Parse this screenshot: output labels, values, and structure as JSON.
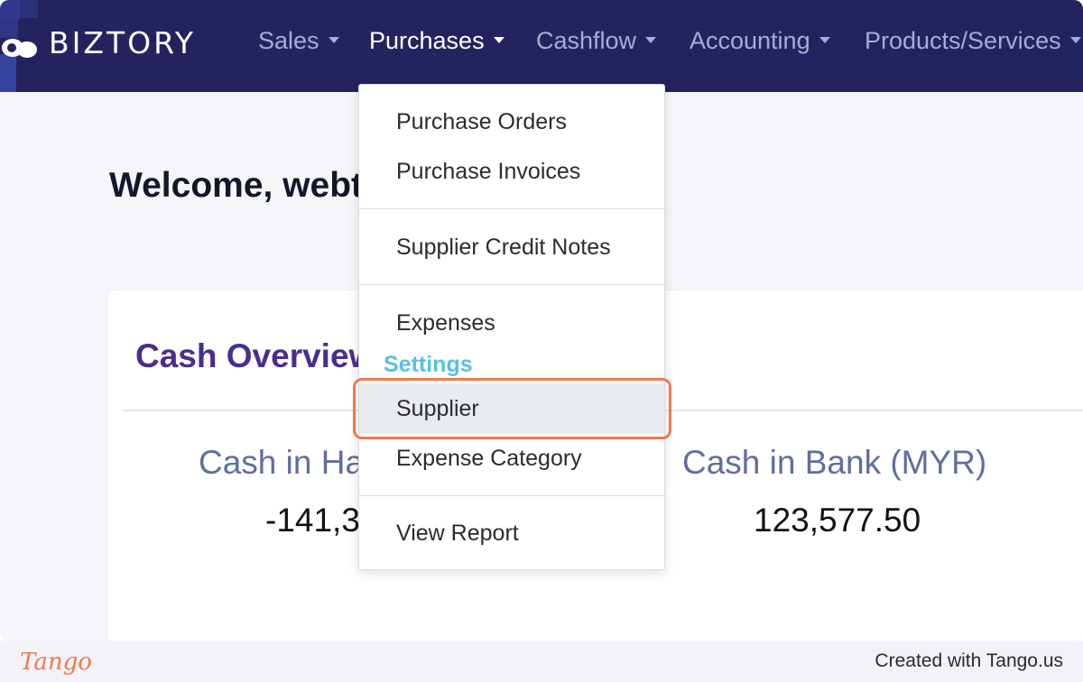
{
  "brand": {
    "name": "BIZTORY"
  },
  "nav": {
    "items": [
      {
        "label": "Sales"
      },
      {
        "label": "Purchases"
      },
      {
        "label": "Cashflow"
      },
      {
        "label": "Accounting"
      },
      {
        "label": "Products/Services"
      }
    ],
    "active": "Purchases"
  },
  "page": {
    "welcome": "Welcome, webt"
  },
  "cash_overview": {
    "title": "Cash Overview",
    "cash_in_hand_label": "Cash in Ha",
    "cash_in_hand_value": "-141,3",
    "cash_in_bank_label": "Cash in Bank (MYR)",
    "cash_in_bank_value": "123,577.50"
  },
  "dropdown": {
    "items": [
      {
        "label": "Purchase Orders"
      },
      {
        "label": "Purchase Invoices"
      },
      {
        "label": "Supplier Credit Notes"
      },
      {
        "label": "Expenses"
      }
    ],
    "settings_header": "Settings",
    "settings_items": [
      {
        "label": "Supplier"
      },
      {
        "label": "Expense Category"
      }
    ],
    "report_item": "View Report",
    "highlighted": "Supplier"
  },
  "footer": {
    "logo": "Tango",
    "credit": "Created with Tango.us"
  },
  "colors": {
    "navbar": "#25235f",
    "active_nav": "#ffffff",
    "inactive_nav": "#a9abd3",
    "card_title": "#4a2e8e",
    "settings_header": "#57c0e6",
    "focus_ring": "#f07a4e"
  }
}
